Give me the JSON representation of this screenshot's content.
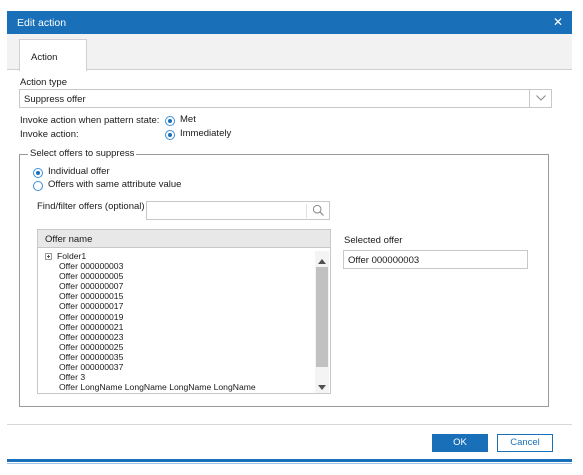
{
  "dialog": {
    "title": "Edit action",
    "close_glyph": "✕"
  },
  "tabs": [
    {
      "label": "Action"
    }
  ],
  "action_type": {
    "label": "Action type",
    "value": "Suppress offer"
  },
  "invoke_state": {
    "label": "Invoke action when pattern state:",
    "option": "Met"
  },
  "invoke_action": {
    "label": "Invoke action:",
    "option": "Immediately"
  },
  "offers_group": {
    "legend": "Select offers to suppress",
    "options": [
      {
        "label": "Individual offer",
        "checked": true
      },
      {
        "label": "Offers with same attribute value",
        "checked": false
      }
    ],
    "find_label": "Find/filter offers (optional)",
    "find_value": "",
    "list_header": "Offer name",
    "folder": "Folder1",
    "offers": [
      "Offer 000000003",
      "Offer 000000005",
      "Offer 000000007",
      "Offer 000000015",
      "Offer 000000017",
      "Offer 000000019",
      "Offer 000000021",
      "Offer 000000023",
      "Offer 000000025",
      "Offer 000000035",
      "Offer 000000037",
      "Offer 3",
      "Offer LongName LongName LongName LongName"
    ],
    "selected_label": "Selected offer",
    "selected_value": "Offer 000000003"
  },
  "buttons": {
    "ok": "OK",
    "cancel": "Cancel"
  },
  "colors": {
    "accent": "#1a70b8"
  }
}
